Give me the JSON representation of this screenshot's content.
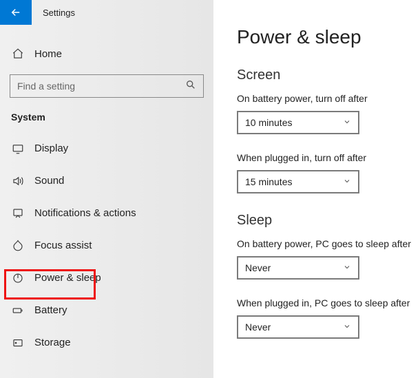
{
  "app_title": "Settings",
  "home_label": "Home",
  "search_placeholder": "Find a setting",
  "section_label": "System",
  "nav": {
    "items": [
      {
        "label": "Display"
      },
      {
        "label": "Sound"
      },
      {
        "label": "Notifications & actions"
      },
      {
        "label": "Focus assist"
      },
      {
        "label": "Power & sleep"
      },
      {
        "label": "Battery"
      },
      {
        "label": "Storage"
      }
    ]
  },
  "content": {
    "title": "Power & sleep",
    "screen_head": "Screen",
    "screen_battery_label": "On battery power, turn off after",
    "screen_battery_value": "10 minutes",
    "screen_plugged_label": "When plugged in, turn off after",
    "screen_plugged_value": "15 minutes",
    "sleep_head": "Sleep",
    "sleep_battery_label": "On battery power, PC goes to sleep after",
    "sleep_battery_value": "Never",
    "sleep_plugged_label": "When plugged in, PC goes to sleep after",
    "sleep_plugged_value": "Never"
  }
}
